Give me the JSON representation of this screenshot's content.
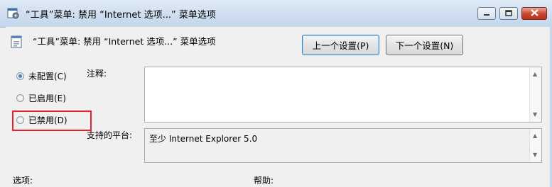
{
  "window": {
    "title": "“工具”菜单: 禁用 “Internet 选项...” 菜单选项",
    "buttons": {
      "minimize": "minimize",
      "maximize": "maximize",
      "close": "close"
    }
  },
  "setting": {
    "title": "“工具”菜单: 禁用 “Internet 选项...” 菜单选项",
    "prev_button": "上一个设置(P)",
    "next_button": "下一个设置(N)"
  },
  "options": {
    "not_configured": "未配置(C)",
    "enabled": "已启用(E)",
    "disabled": "已禁用(D)",
    "selected": "not_configured"
  },
  "comment": {
    "label": "注释:",
    "value": ""
  },
  "platform": {
    "label": "支持的平台:",
    "value": "至少 Internet Explorer 5.0"
  },
  "sections": {
    "options_label": "选项:",
    "help_label": "帮助:"
  },
  "colors": {
    "highlight": "#e8212a",
    "titlebar": "#cfdef0",
    "close_button": "#c9442e"
  },
  "icons": {
    "title": "policy-window-icon",
    "setting": "policy-setting-icon"
  }
}
